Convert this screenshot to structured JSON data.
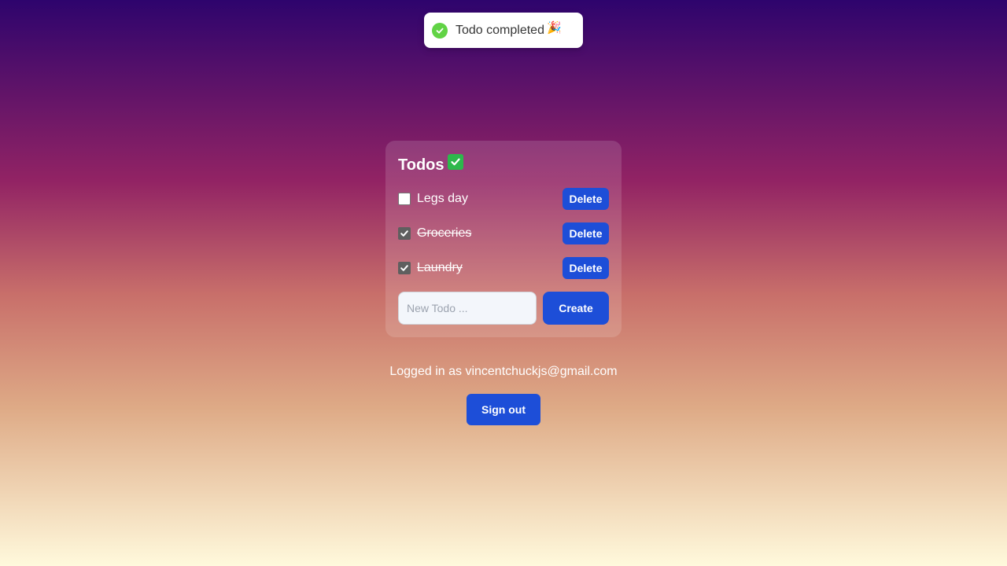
{
  "toast": {
    "message": "Todo completed",
    "emoji": "🎉",
    "status_icon": "check-circle-icon",
    "status_color": "#61d345"
  },
  "card": {
    "title": "Todos",
    "title_emoji_icon": "check-mark-button-icon",
    "todos": [
      {
        "label": "Legs day",
        "completed": false,
        "delete_label": "Delete"
      },
      {
        "label": "Groceries",
        "completed": true,
        "delete_label": "Delete"
      },
      {
        "label": "Laundry",
        "completed": true,
        "delete_label": "Delete"
      }
    ],
    "new_todo": {
      "value": "",
      "placeholder": "New Todo ...",
      "create_label": "Create"
    }
  },
  "account": {
    "logged_in_text": "Logged in as vincentchuckjs@gmail.com",
    "signout_label": "Sign out"
  },
  "colors": {
    "primary_button": "#1d4ed8",
    "toast_success": "#61d345",
    "background_top": "#2e046d",
    "background_bottom": "#fff9dc"
  }
}
